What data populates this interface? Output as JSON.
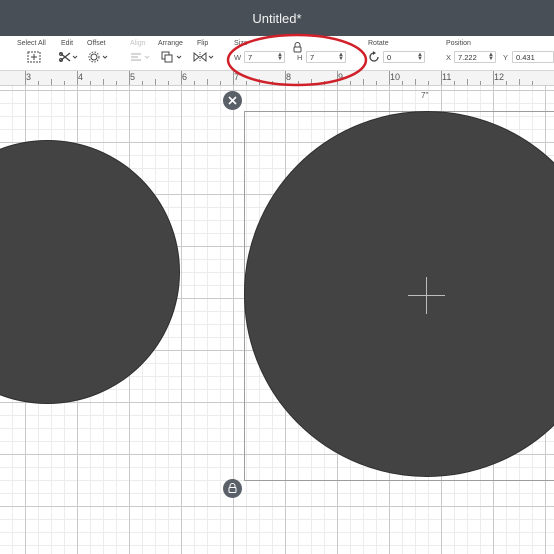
{
  "window": {
    "title": "Untitled*"
  },
  "toolbar": {
    "select_all": {
      "label": "Select All",
      "icon": "select-all-icon"
    },
    "edit": {
      "label": "Edit",
      "icon": "edit-icon"
    },
    "offset": {
      "label": "Offset",
      "icon": "offset-icon"
    },
    "align": {
      "label": "Align",
      "icon": "align-icon",
      "enabled": false
    },
    "arrange": {
      "label": "Arrange",
      "icon": "arrange-icon"
    },
    "flip": {
      "label": "Flip",
      "icon": "flip-icon"
    },
    "size": {
      "label": "Size",
      "w_label": "W",
      "w_value": "7",
      "h_label": "H",
      "h_value": "7",
      "lock_icon": "lock-icon"
    },
    "rotate": {
      "label": "Rotate",
      "value": "0",
      "icon": "rotate-icon"
    },
    "position": {
      "label": "Position",
      "x_label": "X",
      "x_value": "7.222",
      "y_label": "Y",
      "y_value": "0.431"
    }
  },
  "ruler": {
    "numbers": [
      "3",
      "4",
      "5",
      "6",
      "7",
      "8",
      "9",
      "10",
      "11",
      "12"
    ]
  },
  "canvas": {
    "selection_dimension_label": "7\"",
    "delete_icon": "close-icon",
    "lock_aspect_icon": "lock-icon"
  },
  "colors": {
    "titlebar": "#484f56",
    "shape_fill": "#434343",
    "highlight_annotation": "#d0202a"
  }
}
